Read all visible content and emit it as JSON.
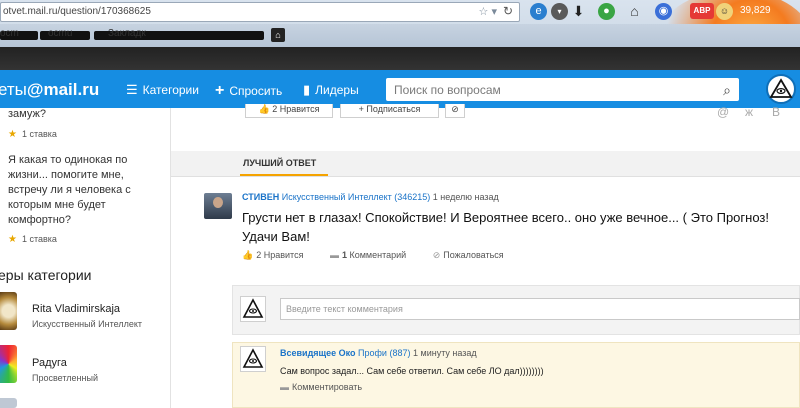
{
  "browser": {
    "url": "otvet.mail.ru/question/170368625",
    "bookmark_text_1": "ocm",
    "bookmark_text_2": "ocmu",
    "bookmark_text_3": "Закладк",
    "counter": "39,829",
    "addon_label": "ABP"
  },
  "header": {
    "logo_prefix": "еты",
    "logo_brand": "@mail.ru",
    "nav": {
      "categories": "Категории",
      "ask": "Спросить",
      "leaders": "Лидеры"
    },
    "search_placeholder": "Поиск по вопросам"
  },
  "sidebar": {
    "questions": [
      {
        "text": "замуж?",
        "rating": "1 ставка"
      },
      {
        "text": "Я какая то одинокая по жизни... помогите мне, встречу ли я человека с которым мне будет комфортно?",
        "rating": "1 ставка"
      }
    ],
    "leaders_title": "еры категории",
    "leaders": [
      {
        "name": "Rita Vladimirskaja",
        "role": "Искусственный Интеллект"
      },
      {
        "name": "Радуга",
        "role": "Просветленный"
      }
    ]
  },
  "question_actions": {
    "like": "2 Нравится",
    "subscribe": "Подписаться"
  },
  "best_answer": {
    "label": "ЛУЧШИЙ ОТВЕТ",
    "author": "СТИВЕН",
    "rank": "Искусственный Интеллект (346215)",
    "time": "1 неделю назад",
    "text": "Грусти нет в глазах! Спокойствие! И Вероятнее всего.. оно уже вечное... ( Это Прогноз! Удачи Вам!",
    "likes": "2 Нравится",
    "comments_count": "1",
    "comments_label": "Комментарий",
    "report": "Пожаловаться"
  },
  "comment_form": {
    "placeholder": "Введите текст комментария"
  },
  "reply": {
    "author": "Всевидящее Око",
    "rank": "Профи (887)",
    "time": "1 минуту назад",
    "text": "Сам вопрос задал... Сам себе ответил. Сам себе ЛО дал))))))))",
    "action": "Комментировать"
  },
  "colors": {
    "brand_blue": "#168de2",
    "accent_orange": "#f5a300",
    "link_blue": "#1a73c8"
  }
}
